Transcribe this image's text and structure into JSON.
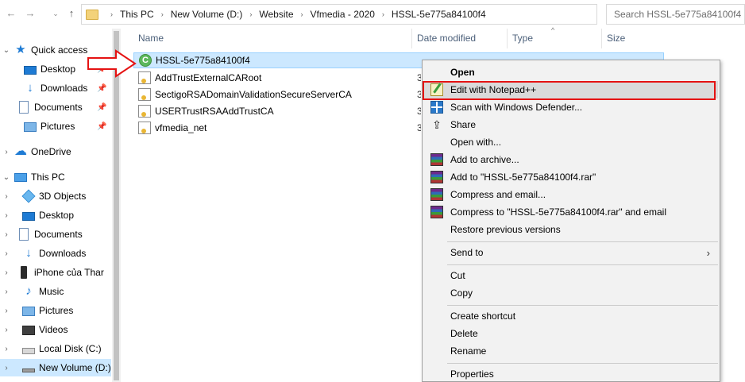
{
  "address": {
    "crumbs": [
      "This PC",
      "New Volume (D:)",
      "Website",
      "Vfmedia - 2020",
      "HSSL-5e775a84100f4"
    ],
    "search_placeholder": "Search HSSL-5e775a84100f4"
  },
  "nav": {
    "items": [
      {
        "label": "Quick access",
        "icon": "star-icon"
      },
      {
        "label": "Desktop",
        "icon": "desktop-icon"
      },
      {
        "label": "Downloads",
        "icon": "download-icon"
      },
      {
        "label": "Documents",
        "icon": "documents-icon"
      },
      {
        "label": "Pictures",
        "icon": "pictures-icon"
      },
      {
        "label": "OneDrive",
        "icon": "cloud-icon"
      },
      {
        "label": "This PC",
        "icon": "computer-icon"
      },
      {
        "label": "3D Objects",
        "icon": "cube-icon"
      },
      {
        "label": "Desktop",
        "icon": "desktop-icon"
      },
      {
        "label": "Documents",
        "icon": "documents-icon"
      },
      {
        "label": "Downloads",
        "icon": "download-icon"
      },
      {
        "label": "iPhone của Thar",
        "icon": "phone-icon"
      },
      {
        "label": "Music",
        "icon": "music-icon"
      },
      {
        "label": "Pictures",
        "icon": "pictures-icon"
      },
      {
        "label": "Videos",
        "icon": "video-icon"
      },
      {
        "label": "Local Disk (C:)",
        "icon": "disk-icon"
      },
      {
        "label": "New Volume (D:)",
        "icon": "drive-icon"
      }
    ]
  },
  "columns": {
    "name": "Name",
    "date": "Date modified",
    "type": "Type",
    "size": "Size"
  },
  "files": [
    {
      "name": "HSSL-5e775a84100f4",
      "icon": "cert-green-icon",
      "selected": true
    },
    {
      "name": "AddTrustExternalCARoot",
      "icon": "certificate-icon"
    },
    {
      "name": "SectigoRSADomainValidationSecureServerCA",
      "icon": "certificate-icon"
    },
    {
      "name": "USERTrustRSAAddTrustCA",
      "icon": "certificate-icon"
    },
    {
      "name": "vfmedia_net",
      "icon": "certificate-icon"
    }
  ],
  "file_date_stub": "3",
  "context_menu": {
    "items": [
      {
        "label": "Open",
        "bold": true
      },
      {
        "label": "Edit with Notepad++",
        "icon": "notepad-plus-plus-icon",
        "highlighted": true
      },
      {
        "label": "Scan with Windows Defender...",
        "icon": "defender-icon"
      },
      {
        "label": "Share",
        "icon": "share-icon"
      },
      {
        "label": "Open with..."
      },
      {
        "label": "Add to archive...",
        "icon": "winrar-icon"
      },
      {
        "label": "Add to \"HSSL-5e775a84100f4.rar\"",
        "icon": "winrar-icon"
      },
      {
        "label": "Compress and email...",
        "icon": "winrar-icon"
      },
      {
        "label": "Compress to \"HSSL-5e775a84100f4.rar\" and email",
        "icon": "winrar-icon"
      },
      {
        "label": "Restore previous versions"
      },
      {
        "label": "Send to",
        "submenu": true
      },
      {
        "label": "Cut"
      },
      {
        "label": "Copy"
      },
      {
        "label": "Create shortcut"
      },
      {
        "label": "Delete"
      },
      {
        "label": "Rename"
      },
      {
        "label": "Properties"
      }
    ]
  },
  "colors": {
    "selection": "#cce8ff",
    "annotation_red": "#e51313",
    "menu_bg": "#f2f2f2"
  }
}
